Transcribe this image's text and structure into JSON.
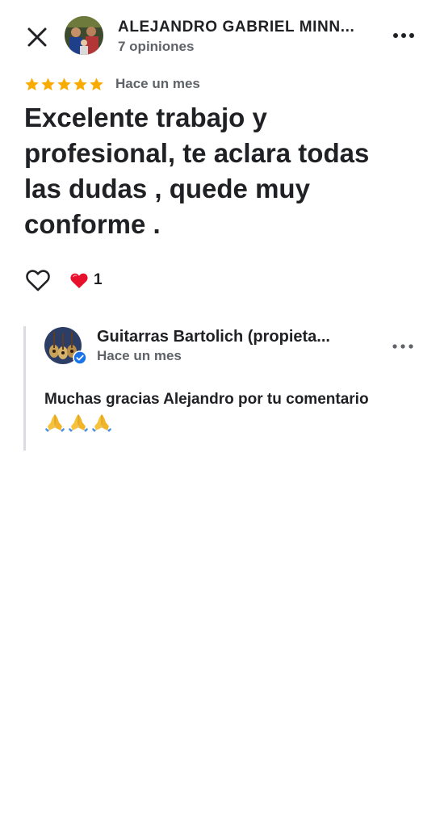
{
  "review": {
    "author_name": "ALEJANDRO GABRIEL MINN...",
    "author_reviews": "7 opiniones",
    "rating": 5,
    "date": "Hace un mes",
    "text": "Excelente trabajo y profesional, te aclara todas las dudas , quede muy conforme .",
    "reaction_count": "1"
  },
  "reply": {
    "owner_name": "Guitarras Bartolich (propieta...",
    "date": "Hace un mes",
    "text": "Muchas gracias Alejandro por tu comentario",
    "emoji_count": 3
  },
  "colors": {
    "star": "#f9ab00",
    "heart": "#e8112d",
    "verified": "#1a73e8",
    "muted_text": "#5f6368"
  },
  "icons": {
    "close": "close-icon",
    "more": "more-horizontal-icon",
    "like": "heart-outline-icon",
    "reaction": "red-heart-icon",
    "verified": "verified-badge-icon",
    "emoji": "folded-hands-icon"
  }
}
